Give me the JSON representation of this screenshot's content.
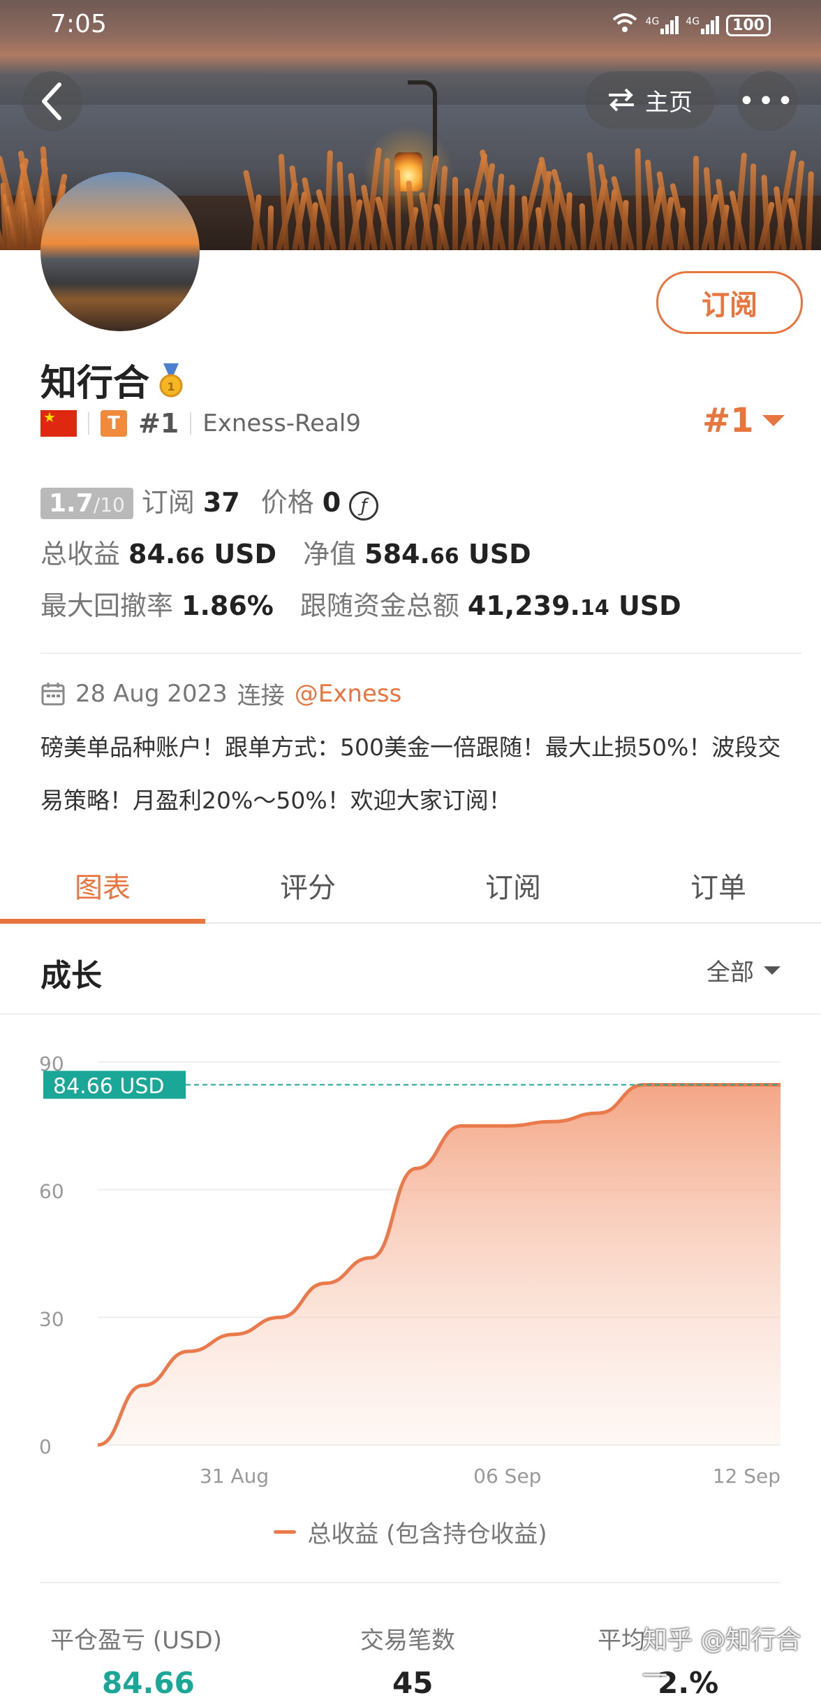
{
  "status_bar": {
    "time": "7:05",
    "network_1": "4G",
    "network_2": "4G",
    "battery": "100"
  },
  "top_nav": {
    "home_label": "主页"
  },
  "profile": {
    "name": "知行合",
    "rank_small": "#1",
    "t_badge": "T",
    "account": "Exness-Real9",
    "rank_right": "#1",
    "subscribe_label": "订阅"
  },
  "stats": {
    "score": "1.7",
    "score_max": "/10",
    "subscribe_label": "订阅",
    "subscribe_count": "37",
    "price_label": "价格",
    "price_value": "0",
    "currency_symbol": "ƒ",
    "total_profit_label": "总收益",
    "total_profit_int": "84.",
    "total_profit_dec": "66",
    "total_profit_unit": "USD",
    "equity_label": "净值",
    "equity_int": "584.",
    "equity_dec": "66",
    "equity_unit": "USD",
    "drawdown_label": "最大回撤率",
    "drawdown_value": "1.86%",
    "follow_label": "跟随资金总额",
    "follow_int": "41,239.",
    "follow_dec": "14",
    "follow_unit": "USD"
  },
  "connect": {
    "date": "28 Aug 2023",
    "text": "连接",
    "broker": "@Exness"
  },
  "description": "磅美单品种账户！跟单方式：500美金一倍跟随！最大止损50%！波段交易策略！月盈利20%～50%！欢迎大家订阅！",
  "tabs": [
    "图表",
    "评分",
    "订阅",
    "订单"
  ],
  "section": {
    "title": "成长",
    "filter": "全部"
  },
  "chart_data": {
    "type": "area",
    "y_ticks": [
      "90",
      "60",
      "30",
      "0"
    ],
    "x_ticks": [
      "31 Aug",
      "06 Sep",
      "12 Sep"
    ],
    "ylim": [
      0,
      90
    ],
    "current_label": "84.66 USD",
    "current_value": 84.66,
    "x": [
      "28 Aug",
      "29 Aug",
      "30 Aug",
      "31 Aug",
      "01 Sep",
      "02 Sep",
      "03 Sep",
      "04 Sep",
      "05 Sep",
      "06 Sep",
      "07 Sep",
      "08 Sep",
      "09 Sep",
      "10 Sep",
      "11 Sep",
      "12 Sep"
    ],
    "series": [
      {
        "name": "总收益 (包含持仓收益)",
        "values": [
          0,
          14,
          22,
          26,
          30,
          38,
          44,
          65,
          75,
          75,
          76,
          78,
          84.66,
          84.66,
          84.66,
          84.66
        ]
      }
    ],
    "color": "#ea7a4c",
    "marker_color": "#1aa797"
  },
  "legend": {
    "label": "总收益 (包含持仓收益)"
  },
  "bottom_stats": {
    "labels": [
      "平仓盈亏 (USD)",
      "交易笔数",
      "平均"
    ],
    "values": [
      "84.66",
      "45",
      "2.%"
    ]
  },
  "watermark": "知乎 @知行合一"
}
